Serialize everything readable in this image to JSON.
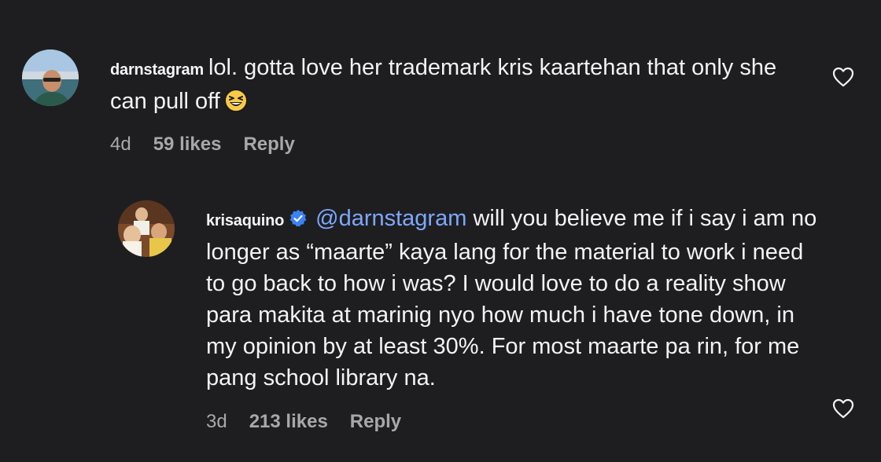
{
  "comments": [
    {
      "username": "darnstagram",
      "text": "lol. gotta love her trademark kris kaartehan that only she can pull off",
      "time": "4d",
      "likes": "59 likes",
      "reply_label": "Reply"
    },
    {
      "username": "krisaquino",
      "mention": "@darnstagram",
      "text": " will you believe me if i say i am no longer as “maarte” kaya lang for the material to work i need to go back to how i was? I would love to do a reality show para makita at marinig nyo how much i have tone down, in my opinion by at least 30%. For most maarte pa rin, for me pang school library na.",
      "time": "3d",
      "likes": "213 likes",
      "reply_label": "Reply"
    }
  ],
  "icons": {
    "like": "heart-outline-icon",
    "verified": "verified-badge-icon",
    "emoji": "grinning-squinting-face-emoji"
  },
  "colors": {
    "background": "#1e1e20",
    "mention": "#7ea7ff",
    "verified": "#3b82f6",
    "meta": "#a8a8a8"
  }
}
